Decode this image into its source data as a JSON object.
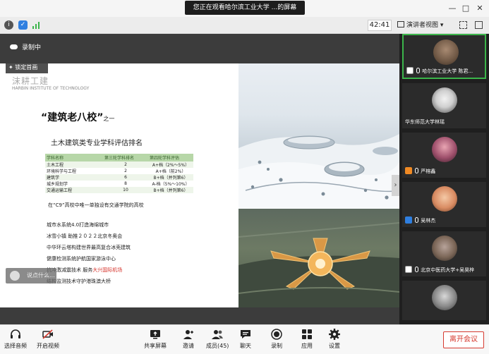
{
  "titlebar": {
    "share_banner": "您正在观看哈尔滨工业大学 ...的屏幕",
    "minimize": "—",
    "maximize": "□",
    "close": "✕"
  },
  "meetbar": {
    "timer": "42:41",
    "view_label": "演讲者视图",
    "view_caret": "▾"
  },
  "recording": {
    "label": "录制中"
  },
  "pin": {
    "label": "锁定首画"
  },
  "slide": {
    "uni_cn": "沫耕工建",
    "uni_en": "HARBIN INSTITUTE OF TECHNOLOGY",
    "title": "“建筑老八校”",
    "title_suffix": "之一",
    "subtitle": "土木建筑类专业学科评估排名",
    "table": {
      "headers": [
        "学科名称",
        "第三轮学科排名",
        "第四轮学科评估"
      ],
      "rows": [
        [
          "土木工程",
          "2",
          "A+档（2%～5%）"
        ],
        [
          "环境科学与工程",
          "2",
          "A+档（前2%）"
        ],
        [
          "建筑学",
          "6",
          "B+档（并列第6）"
        ],
        [
          "城乡规划学",
          "8",
          "A-档（5%～10%）"
        ],
        [
          "交通运输工程",
          "10",
          "B+档（并列第6）"
        ]
      ]
    },
    "c9_note": "在“C9”高校中唯一单独设有交通学院的高校",
    "bullets": [
      {
        "text": "城市水系统4.0打造海绵城市",
        "highlight": ""
      },
      {
        "text": "冰雪小镇 助推２０２２北京冬奥会",
        "highlight": ""
      },
      {
        "text": "中华环云塔构建世界最高复合冰壳建筑",
        "highlight": ""
      },
      {
        "text": "健康检测系统护航国家游泳中心",
        "highlight": ""
      },
      {
        "text": "抗冲激减震技术 服务",
        "highlight": "大兴国际机场"
      },
      {
        "text": "结构监测技术守护港珠澳大桥",
        "highlight": ""
      }
    ]
  },
  "speak_box": {
    "label": "说点什么..."
  },
  "collapse": {
    "label": "›"
  },
  "participants": [
    {
      "name": "哈尔滨工业大学 陈君...",
      "badge_color": "#ffffff"
    },
    {
      "name": "华东师范大学林瑶",
      "badge_color": ""
    },
    {
      "name": "严榕鑫",
      "badge_color": "#f08a24"
    },
    {
      "name": "吴林杰",
      "badge_color": "#2f7fe0"
    },
    {
      "name": "北京中医药大学+吴昊梓",
      "badge_color": "#ffffff"
    },
    {
      "name": "",
      "badge_color": ""
    }
  ],
  "toolbar": {
    "items": [
      {
        "label": "选择音频",
        "icon": "headset-icon"
      },
      {
        "label": "开启视频",
        "icon": "video-off-icon"
      },
      {
        "label": "共享屏幕",
        "icon": "share-screen-icon"
      },
      {
        "label": "邀请",
        "icon": "invite-icon"
      },
      {
        "label": "成员(45)",
        "icon": "members-icon"
      },
      {
        "label": "聊天",
        "icon": "chat-icon"
      },
      {
        "label": "录制",
        "icon": "record-icon"
      },
      {
        "label": "应用",
        "icon": "apps-icon"
      },
      {
        "label": "设置",
        "icon": "gear-icon"
      }
    ],
    "leave": "离开会议"
  },
  "colors": {
    "accent_green": "#3bb54a",
    "leave_red": "#d63a2f",
    "table_header": "#b7d7a8"
  }
}
